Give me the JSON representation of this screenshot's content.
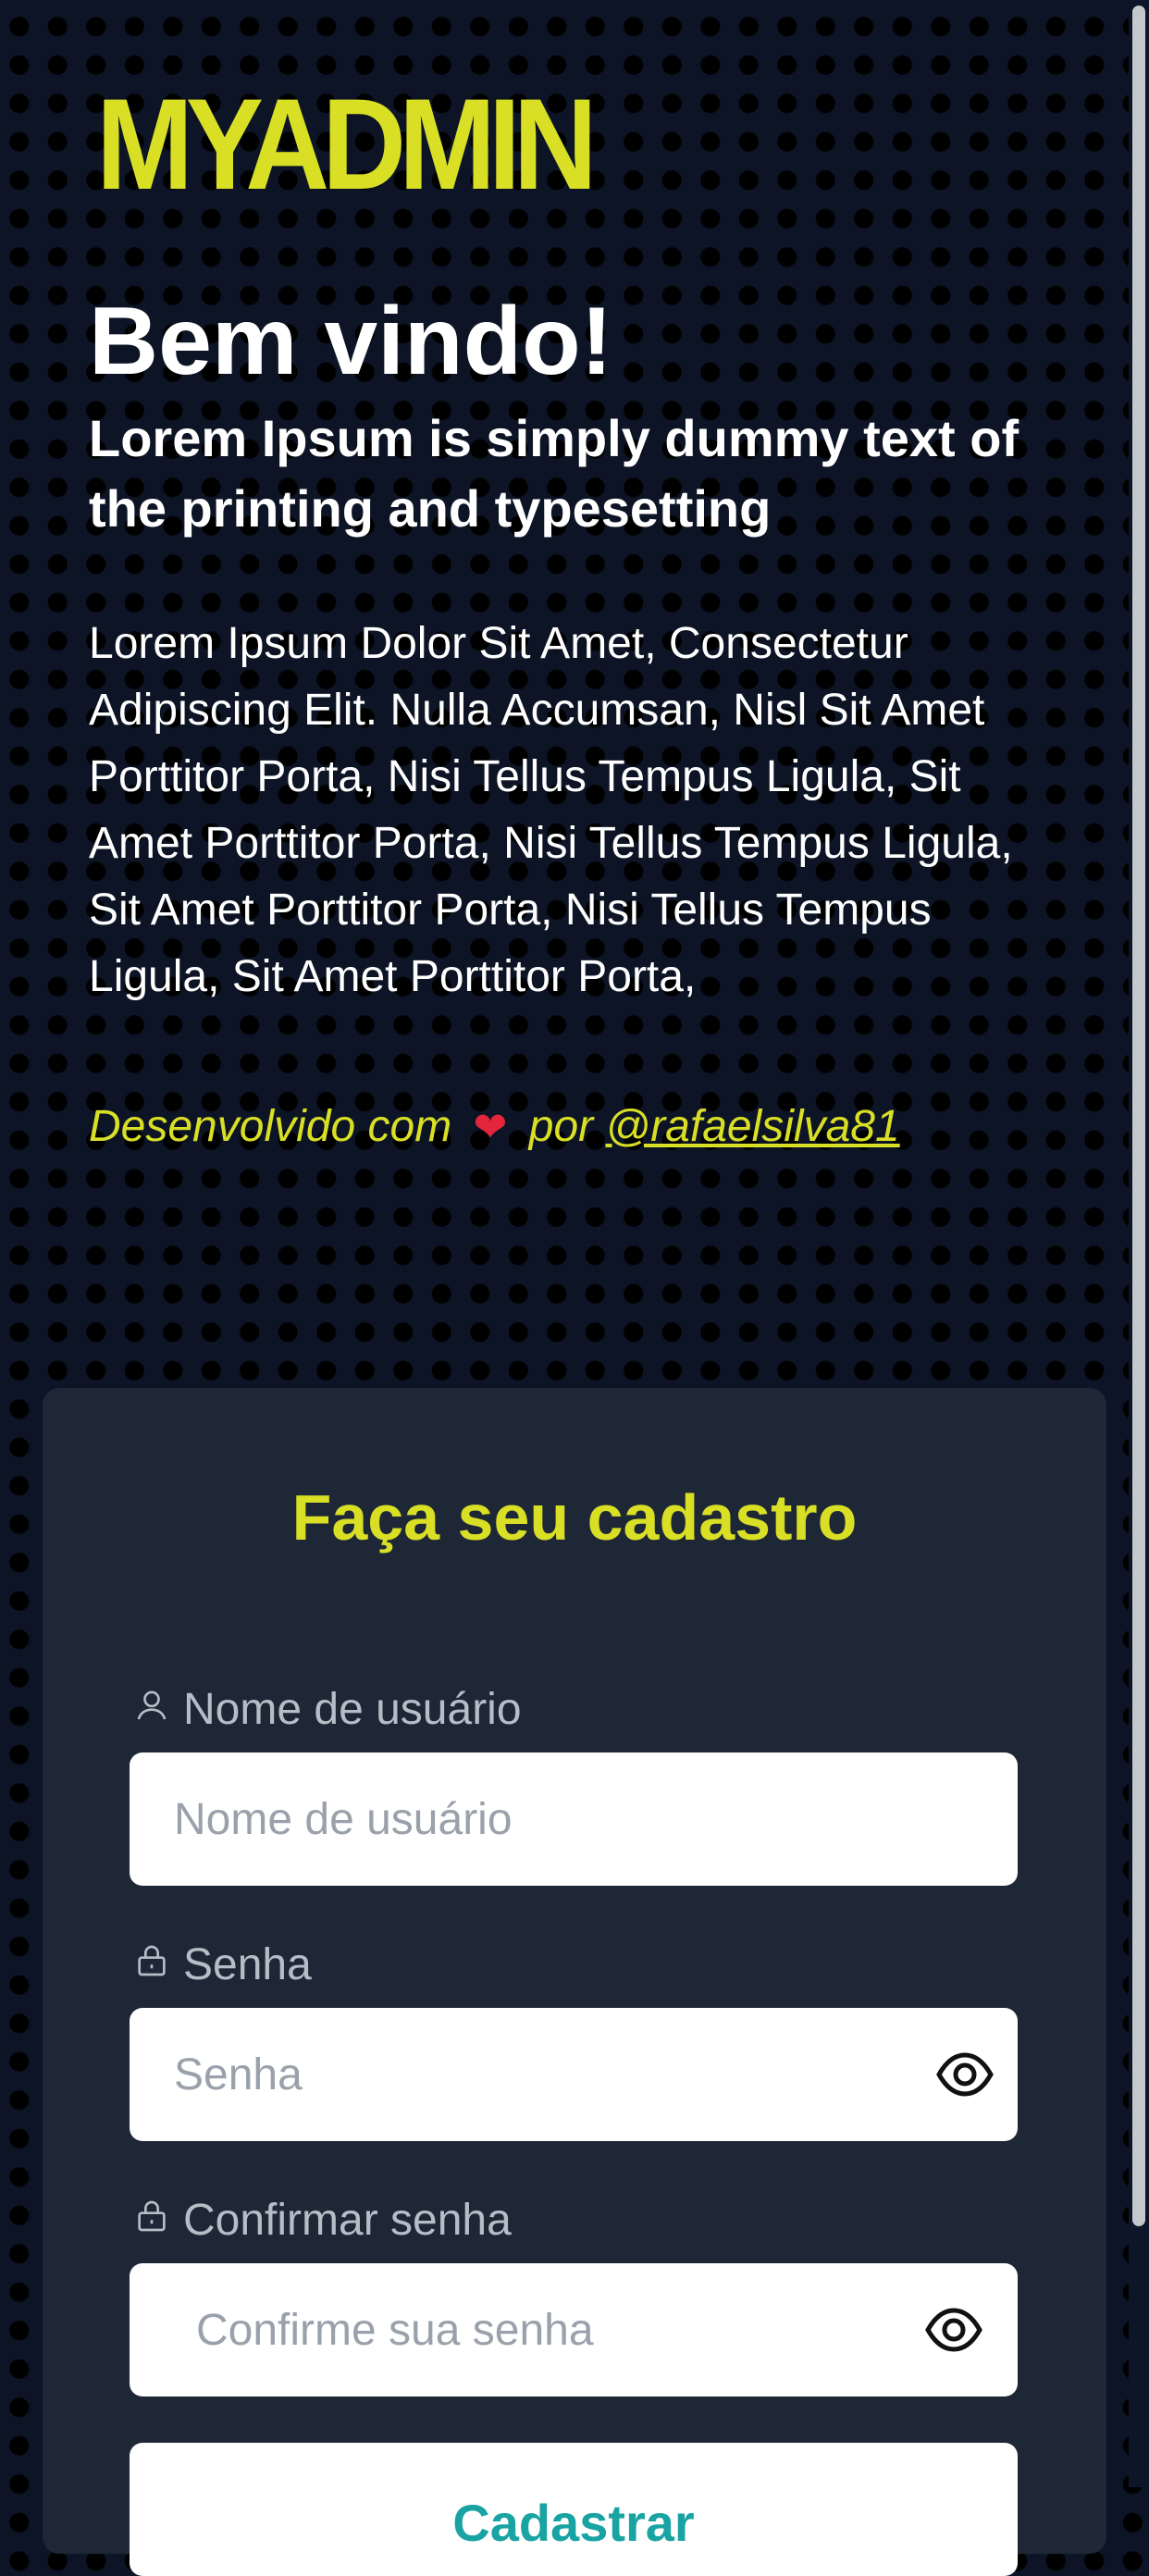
{
  "brand": {
    "logo": "MYADMIN",
    "accent_color": "#d9df25"
  },
  "hero": {
    "title": "Bem vindo!",
    "subtitle": "Lorem Ipsum is simply dummy text of the printing and typesetting",
    "description": "Lorem Ipsum Dolor Sit Amet, Consectetur Adipiscing Elit. Nulla Accumsan, Nisl Sit Amet Porttitor Porta, Nisi Tellus Tempus Ligula, Sit Amet Porttitor Porta, Nisi Tellus Tempus Ligula, Sit Amet Porttitor Porta, Nisi Tellus Tempus Ligula, Sit Amet Porttitor Porta,",
    "credits_prefix": "Desenvolvido com",
    "credits_heart": "❤",
    "credits_by": "por",
    "credits_link": "@rafaelsilva81"
  },
  "form": {
    "title": "Faça seu cadastro",
    "username": {
      "label": "Nome de usuário",
      "placeholder": "Nome de usuário",
      "icon": "user-icon"
    },
    "password": {
      "label": "Senha",
      "placeholder": "Senha",
      "icon": "lock-icon",
      "toggle_icon": "eye-icon"
    },
    "confirm_password": {
      "label": "Confirmar senha",
      "placeholder": "Confirme sua senha",
      "icon": "lock-icon",
      "toggle_icon": "eye-icon"
    },
    "submit_label": "Cadastrar",
    "submit_color": "#1aa3a3"
  },
  "colors": {
    "background": "#0c1425",
    "card": "#1e2736",
    "heart": "#e3263b"
  }
}
